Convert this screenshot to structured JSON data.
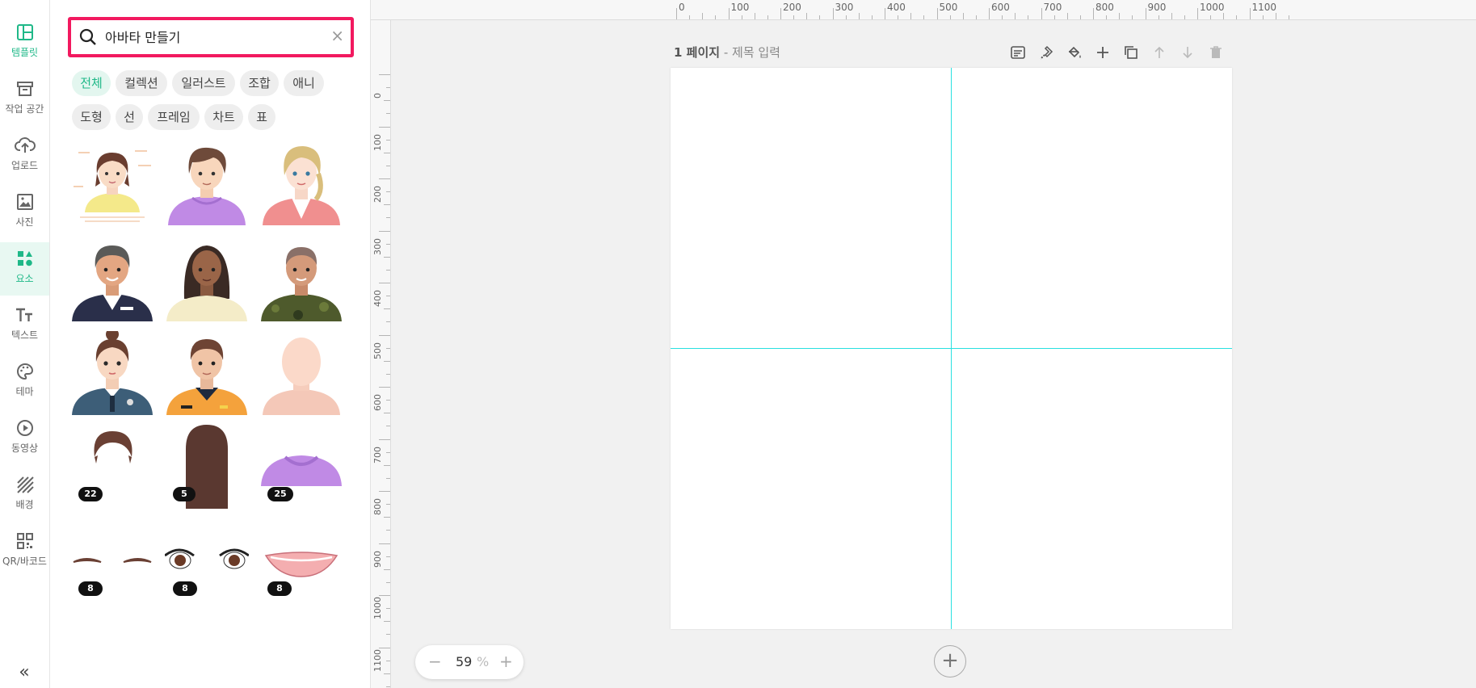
{
  "nav": {
    "items": [
      {
        "label": "템플릿"
      },
      {
        "label": "작업 공간"
      },
      {
        "label": "업로드"
      },
      {
        "label": "사진"
      },
      {
        "label": "요소"
      },
      {
        "label": "텍스트"
      },
      {
        "label": "테마"
      },
      {
        "label": "동영상"
      },
      {
        "label": "배경"
      },
      {
        "label": "QR/바코드"
      }
    ],
    "active": "요소",
    "collapse": "«",
    "accent": "#1fb888"
  },
  "search": {
    "value": "아바타 만들기",
    "clear": "×",
    "highlight": "#f2195f"
  },
  "filters": [
    "전체",
    "컬렉션",
    "일러스트",
    "조합",
    "애니",
    "도형",
    "선",
    "프레임",
    "차트",
    "표"
  ],
  "badges": {
    "hair": "22",
    "long_hair": "5",
    "hoodie": "25",
    "brows": "8",
    "eyes": "8",
    "lips": "8"
  },
  "page": {
    "number": "1 페이지",
    "separator": " - ",
    "title_placeholder": "제목 입력"
  },
  "ruler": {
    "top": [
      "0",
      "100",
      "200",
      "300",
      "400",
      "500",
      "600",
      "700",
      "800",
      "900",
      "1000",
      "1100"
    ],
    "left": [
      "0",
      "100",
      "200",
      "300",
      "400",
      "500",
      "600",
      "700",
      "800",
      "900",
      "1000",
      "1100"
    ]
  },
  "zoom": {
    "out": "−",
    "value": "59",
    "unit": "%",
    "in": "+"
  },
  "add_page": "+",
  "guide_color": "#29e0e0"
}
